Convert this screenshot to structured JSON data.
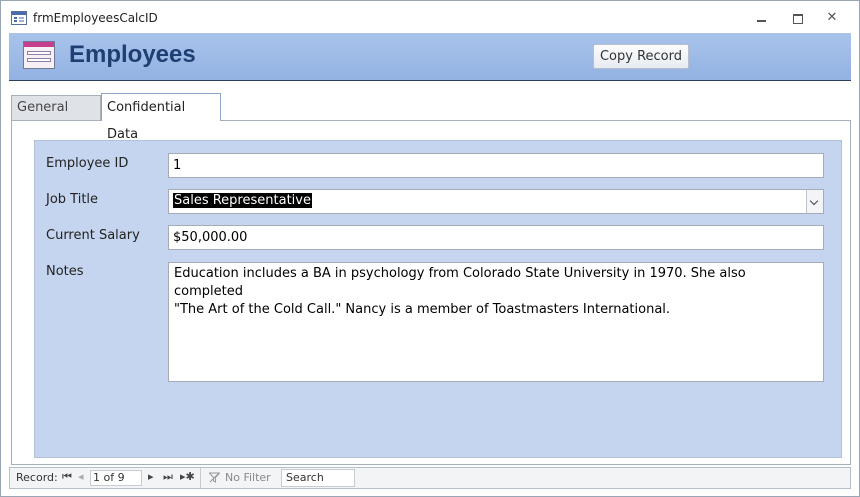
{
  "window": {
    "title": "frmEmployeesCalcID"
  },
  "header": {
    "title": "Employees",
    "copy_button_label": "Copy Record"
  },
  "tabs": [
    {
      "label": "General Data",
      "active": false
    },
    {
      "label": "Confidential Data",
      "active": true
    }
  ],
  "fields": {
    "employee_id": {
      "label": "Employee ID",
      "value": "1"
    },
    "job_title": {
      "label": "Job Title",
      "value": "Sales Representative"
    },
    "current_salary": {
      "label": "Current Salary",
      "value": "$50,000.00"
    },
    "notes": {
      "label": "Notes",
      "line1": "Education includes a BA in psychology from Colorado State University in 1970.  She also completed",
      "line2": "\"The Art of the Cold Call.\"  Nancy is a member of Toastmasters International."
    }
  },
  "navigation": {
    "record_label": "Record:",
    "position": "1 of 9",
    "filter_label": "No Filter",
    "search_placeholder": "Search"
  },
  "colors": {
    "header_band": "#a9c3eb",
    "detail_background": "#c5d5ef",
    "form_title": "#1f3f73"
  }
}
